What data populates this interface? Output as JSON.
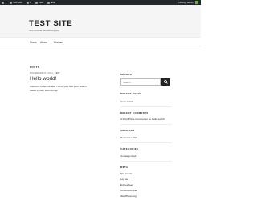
{
  "admin_bar": {
    "items": [
      {
        "label": "Site title",
        "icon": "wordpress-icon"
      },
      {
        "label": "Test Site",
        "icon": "home-icon"
      },
      {
        "label": "0",
        "icon": "comment-icon"
      },
      {
        "label": "New",
        "icon": "plus-icon"
      },
      {
        "label": "Edit",
        "icon": "edit-icon"
      }
    ],
    "account_label": "Howdy, admin",
    "colors": {
      "background": "#23282d",
      "avatar": "#6aa84f"
    }
  },
  "header": {
    "site_title": "TEST SITE",
    "tagline": "Just another WordPress site"
  },
  "nav": {
    "items": [
      {
        "label": "Home"
      },
      {
        "label": "About"
      },
      {
        "label": "Contact"
      }
    ]
  },
  "main": {
    "section_heading": "POSTS",
    "post": {
      "date": "NOVEMBER 21, 2022",
      "edit_label": "EDIT",
      "title": "Hello world!",
      "excerpt": "Welcome to WordPress. This is your first post. Edit or delete it, then start writing!"
    }
  },
  "sidebar": {
    "search": {
      "heading": "SEARCH",
      "placeholder": "Search ...",
      "button_icon": "search-icon"
    },
    "recent_posts": {
      "heading": "RECENT POSTS",
      "items": [
        "Hello world!"
      ]
    },
    "recent_comments": {
      "heading": "RECENT COMMENTS",
      "items": [
        "A WordPress Commenter on Hello world!"
      ]
    },
    "archives": {
      "heading": "ARCHIVES",
      "items": [
        "November 2022"
      ]
    },
    "categories": {
      "heading": "CATEGORIES",
      "items": [
        "Uncategorized"
      ]
    },
    "meta": {
      "heading": "META",
      "items": [
        "Site Admin",
        "Log out",
        "Entries feed",
        "Comments feed",
        "WordPress.org"
      ]
    }
  }
}
